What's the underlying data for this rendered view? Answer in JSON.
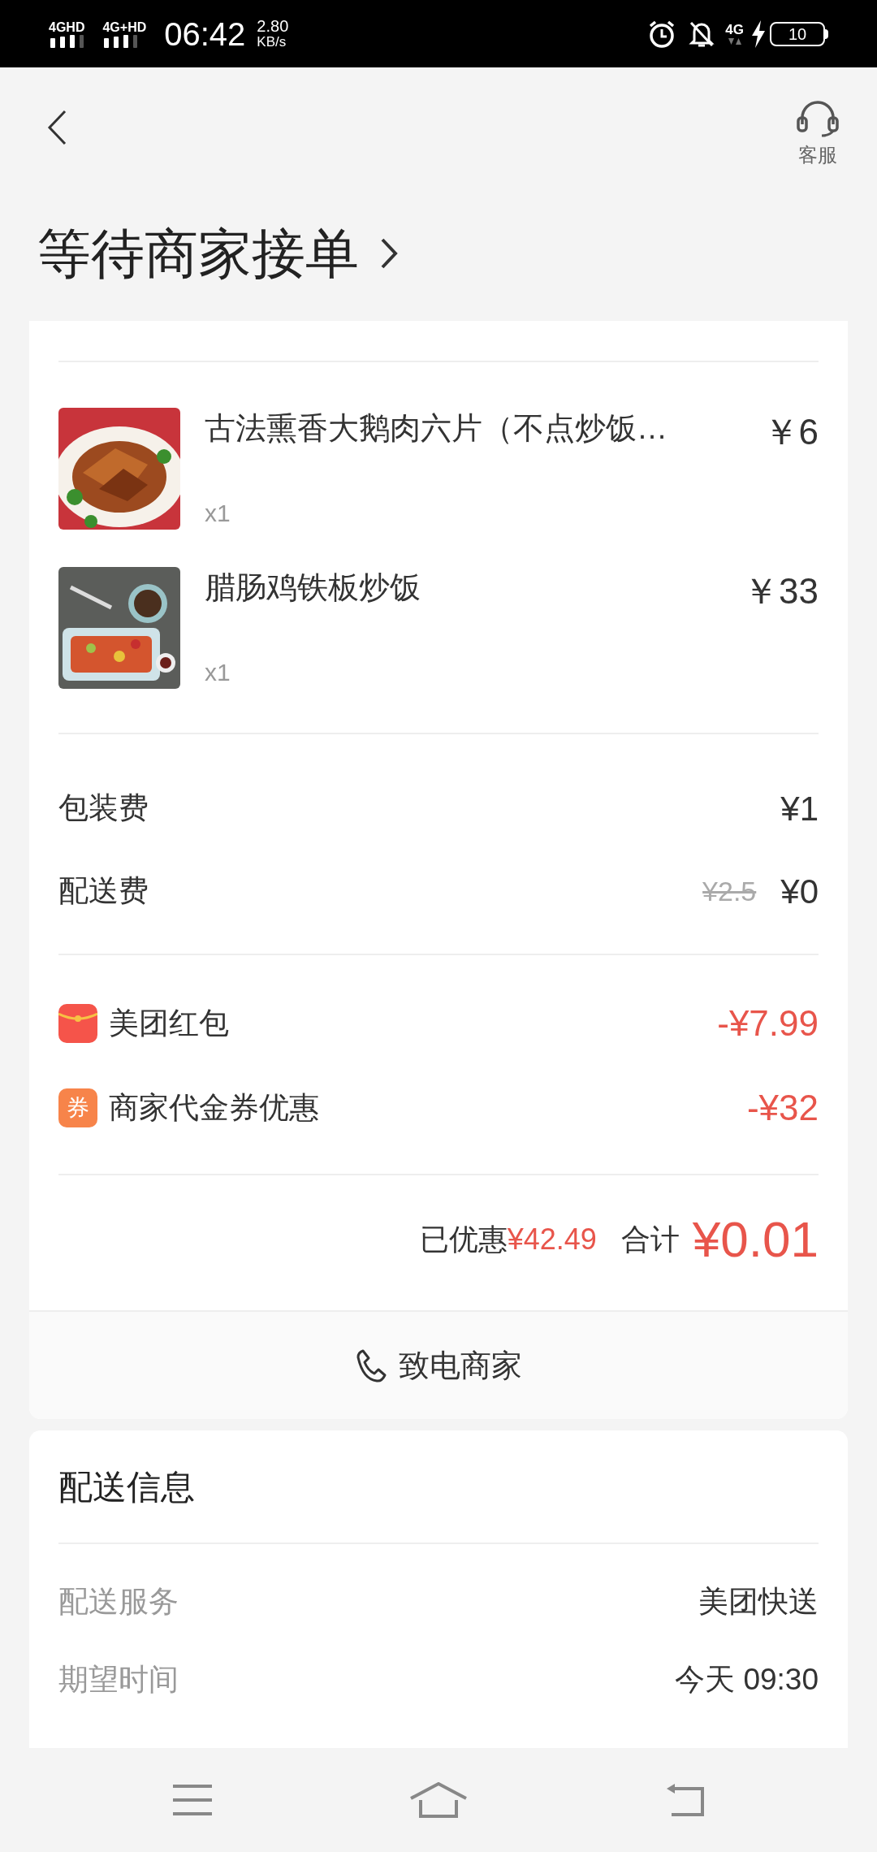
{
  "status_bar": {
    "network_1": "4GHD",
    "network_2": "4G+HD",
    "time": "06:42",
    "speed": "2.80",
    "speed_unit": "KB/s",
    "network_3": "4G",
    "battery": "10"
  },
  "header": {
    "support_label": "客服",
    "title": "等待商家接单"
  },
  "items": [
    {
      "name": "古法熏香大鹅肉六片（不点炒饭…",
      "quantity": "x1",
      "price": "￥6"
    },
    {
      "name": "腊肠鸡铁板炒饭",
      "quantity": "x1",
      "price": "￥33"
    }
  ],
  "fees": [
    {
      "label": "包装费",
      "price": "¥1"
    },
    {
      "label": "配送费",
      "original_price": "¥2.5",
      "price": "¥0"
    }
  ],
  "discounts": [
    {
      "kind": "red_packet",
      "label": "美团红包",
      "amount": "-¥7.99"
    },
    {
      "kind": "voucher",
      "icon_text": "券",
      "label": "商家代金券优惠",
      "amount": "-¥32"
    }
  ],
  "summary": {
    "saved_label": "已优惠",
    "saved_amount": "¥42.49",
    "total_label": "合计",
    "total": "¥0.01"
  },
  "call_button": "致电商家",
  "delivery": {
    "title": "配送信息",
    "rows": [
      {
        "label": "配送服务",
        "value": "美团快送"
      },
      {
        "label": "期望时间",
        "value": "今天 09:30"
      }
    ]
  }
}
